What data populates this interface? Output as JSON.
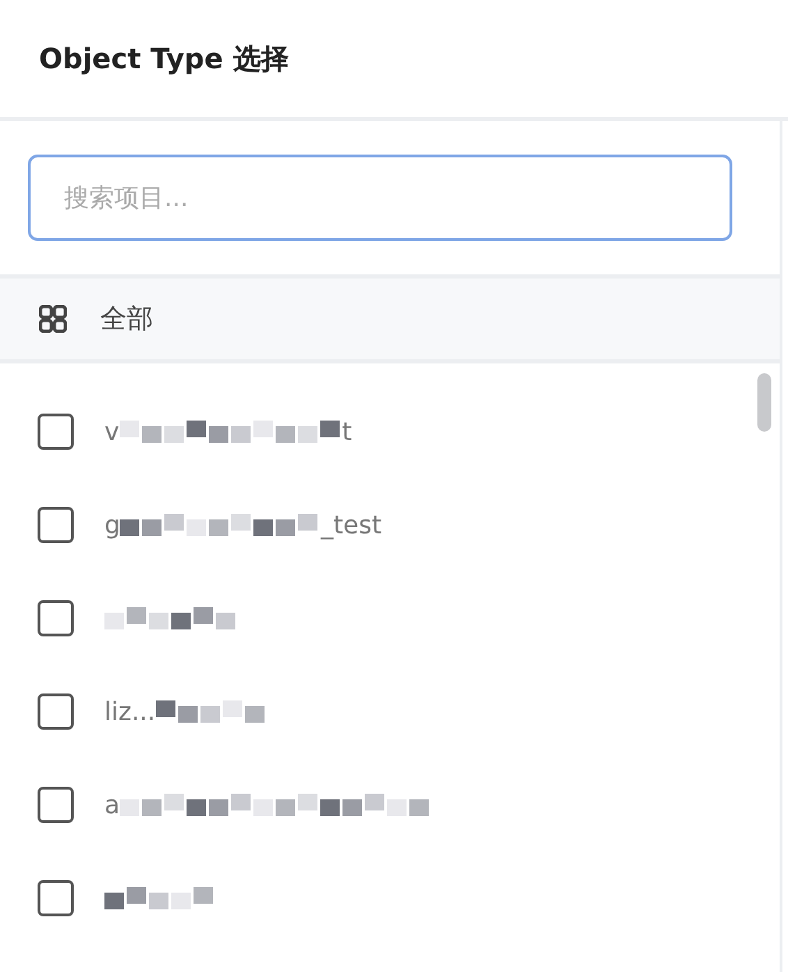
{
  "title": "Object Type 选择",
  "search": {
    "placeholder": "搜索项目..."
  },
  "all_option": {
    "label": "全部"
  },
  "items": [
    {
      "prefix": "v",
      "suffix": "t",
      "checked": false
    },
    {
      "prefix": "g",
      "suffix": "_test",
      "checked": false
    },
    {
      "checked": false
    },
    {
      "prefix": "liz...",
      "checked": false
    },
    {
      "prefix": "a",
      "checked": false
    },
    {
      "checked": false
    }
  ]
}
